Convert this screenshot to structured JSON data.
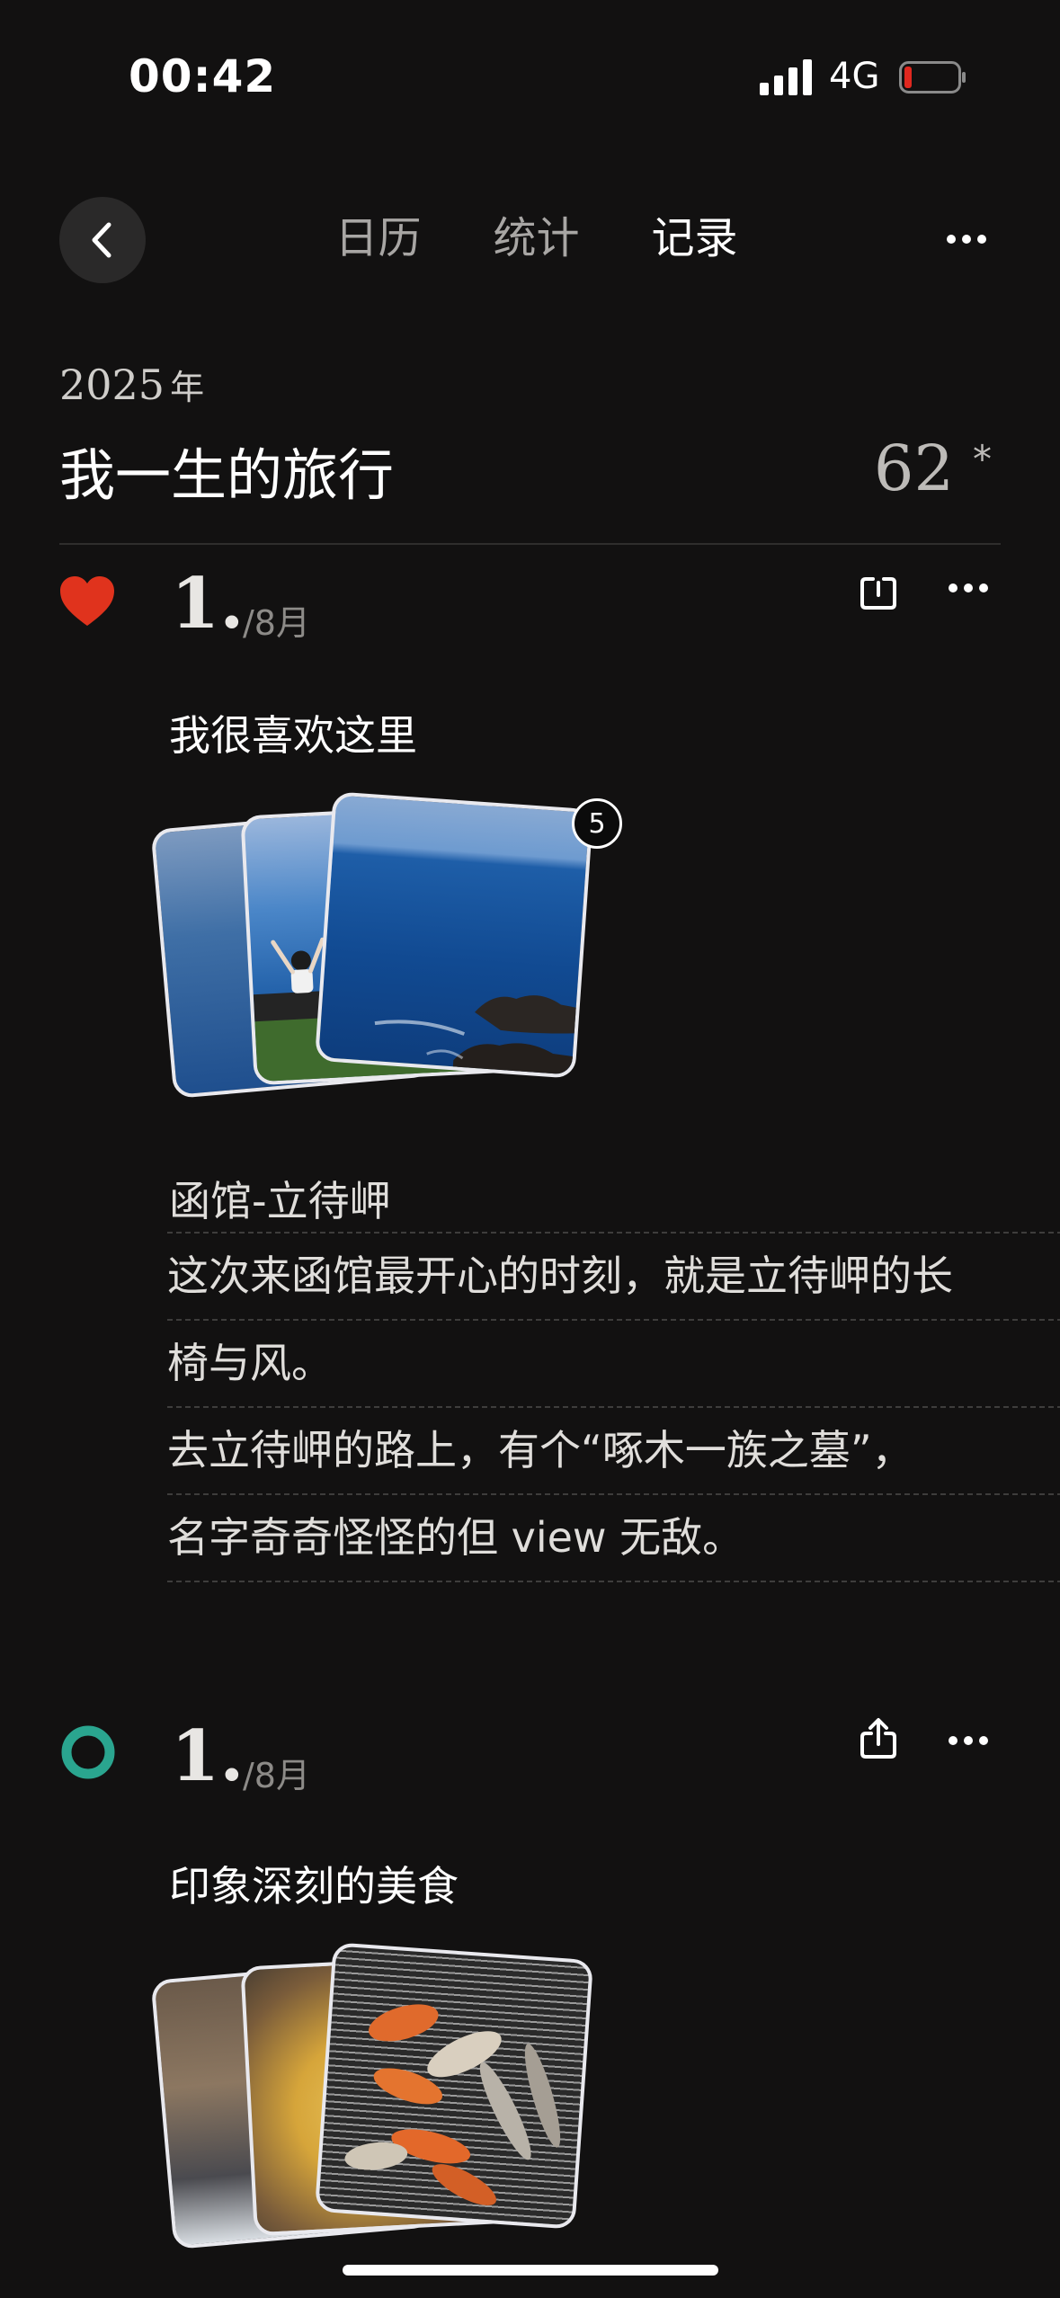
{
  "status_bar": {
    "time": "00:42",
    "network": "4G",
    "battery_color": "#e0281f"
  },
  "nav": {
    "tabs": [
      {
        "label": "日历",
        "active": false
      },
      {
        "label": "统计",
        "active": false
      },
      {
        "label": "记录",
        "active": true
      }
    ]
  },
  "header": {
    "year": "2025",
    "year_unit": "年",
    "title": "我一生的旅行",
    "count": "62",
    "count_suffix": "*"
  },
  "entries": [
    {
      "status_icon": "heart-icon",
      "status_color": "#e0331d",
      "index": "1.",
      "month": "/8月",
      "title": "我很喜欢这里",
      "photo_count": "5",
      "location": "函馆-立待岬",
      "notes": [
        "这次来函馆最开心的时刻，就是立待岬的长",
        "椅与风。",
        "去立待岬的路上，有个“啄木一族之墓”，",
        "名字奇奇怪怪的但 view 无敌。"
      ]
    },
    {
      "status_icon": "ring-icon",
      "status_color": "#2aa58f",
      "index": "1.",
      "month": "/8月",
      "title": "印象深刻的美食"
    }
  ]
}
